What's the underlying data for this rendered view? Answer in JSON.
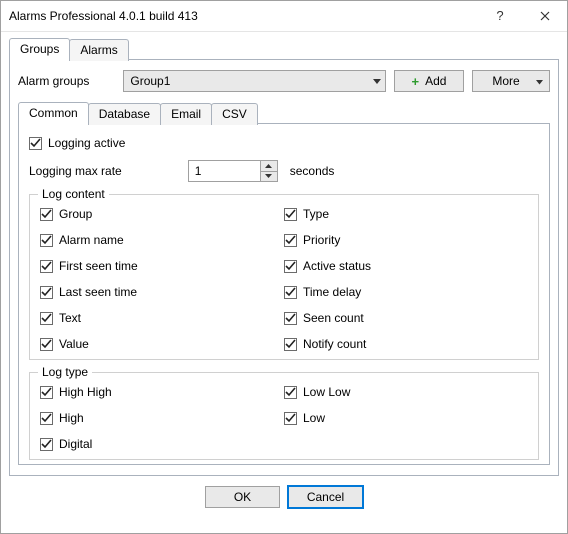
{
  "title": "Alarms Professional 4.0.1 build 413",
  "outerTabs": {
    "t0": "Groups",
    "t1": "Alarms"
  },
  "groupsRow": {
    "label": "Alarm groups",
    "selected": "Group1",
    "add": "Add",
    "more": "More"
  },
  "innerTabs": {
    "t0": "Common",
    "t1": "Database",
    "t2": "Email",
    "t3": "CSV"
  },
  "common": {
    "loggingActive": "Logging active",
    "maxRateLabel": "Logging max rate",
    "maxRateValue": "1",
    "maxRateUnit": "seconds"
  },
  "logContent": {
    "legend": "Log content",
    "left": {
      "c0": "Group",
      "c1": "Alarm name",
      "c2": "First seen time",
      "c3": "Last seen time",
      "c4": "Text",
      "c5": "Value"
    },
    "right": {
      "c0": "Type",
      "c1": "Priority",
      "c2": "Active status",
      "c3": "Time delay",
      "c4": "Seen count",
      "c5": "Notify count"
    }
  },
  "logType": {
    "legend": "Log type",
    "left": {
      "c0": "High High",
      "c1": "High",
      "c2": "Digital"
    },
    "right": {
      "c0": "Low Low",
      "c1": "Low"
    }
  },
  "buttons": {
    "ok": "OK",
    "cancel": "Cancel"
  }
}
